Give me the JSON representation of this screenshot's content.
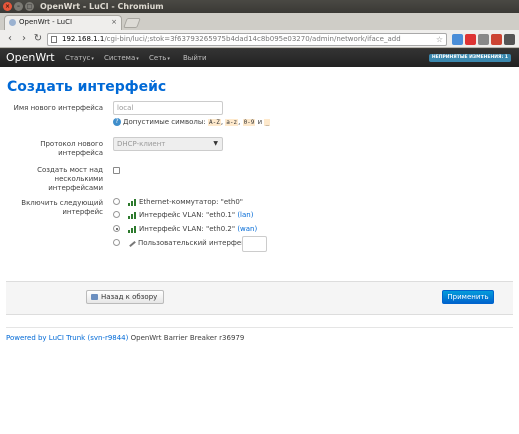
{
  "window": {
    "title": "OpenWrt - LuCI - Chromium",
    "controls": [
      "×",
      "–",
      "□"
    ]
  },
  "browser": {
    "tab_title": "OpenWrt - LuCI",
    "tab_close": "×",
    "url_host": "192.168.1.1",
    "url_path": "/cgi-bin/luci/;stok=3f63793265975b4dad14c8b095e03270/admin/network/iface_add",
    "back": "‹",
    "forward": "›",
    "reload": "↻",
    "star": "☆",
    "extensions": [
      {
        "name": "translate-ext",
        "color": "#4a8ed8"
      },
      {
        "name": "stop-ext",
        "color": "#d33"
      },
      {
        "name": "cloud-ext",
        "color": "#888"
      },
      {
        "name": "camera-ext",
        "color": "#c43"
      },
      {
        "name": "menu-ext",
        "color": "#555"
      }
    ]
  },
  "navbar": {
    "brand": "OpenWrt",
    "menu": [
      {
        "label": "Статус",
        "caret": "▾"
      },
      {
        "label": "Система",
        "caret": "▾"
      },
      {
        "label": "Сеть",
        "caret": "▾"
      },
      {
        "label": "Выйти",
        "caret": ""
      }
    ],
    "changes_badge": "НЕПРИНЯТЫЕ ИЗМЕНЕНИЯ: 1"
  },
  "form": {
    "heading": "Создать интерфейс",
    "name_label": "Имя нового интерфейса",
    "name_value": "local",
    "allowed_text": "Допустимые символы:",
    "allowed_codes": [
      "A-Z",
      "a-z",
      "0-9",
      "_"
    ],
    "allowed_and": "и",
    "protocol_label": "Протокол нового интерфейса",
    "protocol_value": "DHCP-клиент",
    "bridge_label_1": "Создать мост над",
    "bridge_label_2": "несколькими интерфейсами",
    "include_label_1": "Включить следующий",
    "include_label_2": "интерфейс",
    "interfaces": [
      {
        "text": "Ethernet-коммутатор: \"eth0\"",
        "link": "",
        "checked": false
      },
      {
        "text": "Интерфейс VLAN: \"eth0.1\"",
        "link": "(lan)",
        "checked": false
      },
      {
        "text": "Интерфейс VLAN: \"eth0.2\"",
        "link": "(wan)",
        "checked": true
      }
    ],
    "custom_label": "Пользовательский интерфейс:"
  },
  "actions": {
    "back_label": "Назад к обзору",
    "apply_label": "Применить"
  },
  "footer": {
    "powered": "Powered by LuCI Trunk (svn-r9844)",
    "version": "OpenWrt Barrier Breaker r36979"
  }
}
